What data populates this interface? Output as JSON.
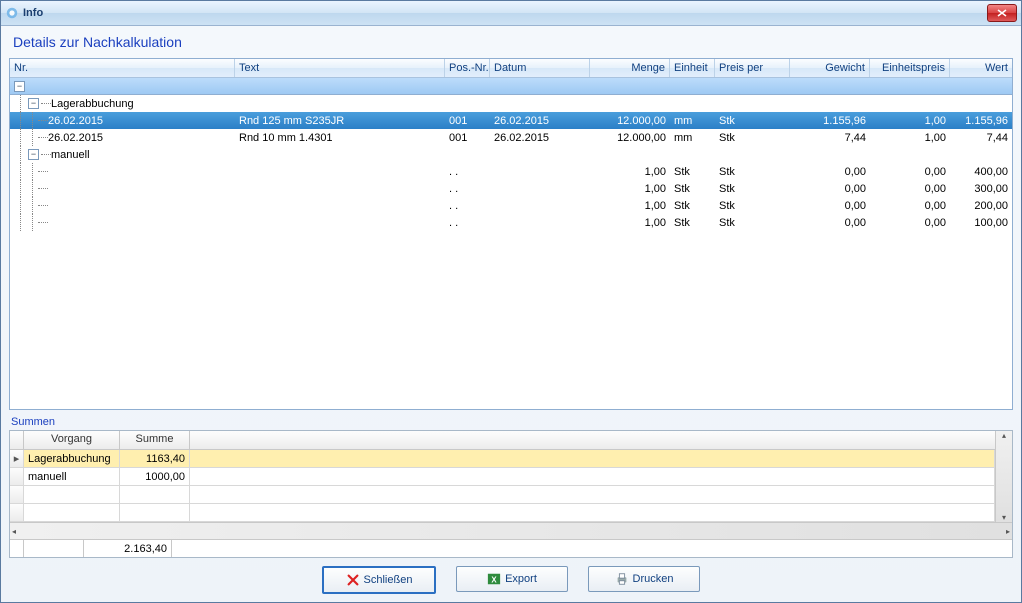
{
  "window": {
    "title": "Info"
  },
  "subtitle": "Details zur Nachkalkulation",
  "grid": {
    "headers": {
      "nr": "Nr.",
      "text": "Text",
      "pos": "Pos.-Nr.",
      "datum": "Datum",
      "menge": "Menge",
      "einheit": "Einheit",
      "preisper": "Preis per",
      "gewicht": "Gewicht",
      "ep": "Einheitspreis",
      "wert": "Wert"
    },
    "groups": [
      {
        "label": "Lagerabbuchung",
        "rows": [
          {
            "nr": "26.02.2015",
            "text": "Rnd 125 mm S235JR",
            "pos": "001",
            "datum": "26.02.2015",
            "menge": "12.000,00",
            "einheit": "mm",
            "preisper": "Stk",
            "gewicht": "1.155,96",
            "ep": "1,00",
            "wert": "1.155,96",
            "selected": true
          },
          {
            "nr": "26.02.2015",
            "text": "Rnd 10 mm 1.4301",
            "pos": "001",
            "datum": "26.02.2015",
            "menge": "12.000,00",
            "einheit": "mm",
            "preisper": "Stk",
            "gewicht": "7,44",
            "ep": "1,00",
            "wert": "7,44"
          }
        ]
      },
      {
        "label": "manuell",
        "rows": [
          {
            "nr": "",
            "text": "",
            "pos": ". .",
            "datum": "",
            "menge": "1,00",
            "einheit": "Stk",
            "preisper": "Stk",
            "gewicht": "0,00",
            "ep": "0,00",
            "wert": "400,00"
          },
          {
            "nr": "",
            "text": "",
            "pos": ". .",
            "datum": "",
            "menge": "1,00",
            "einheit": "Stk",
            "preisper": "Stk",
            "gewicht": "0,00",
            "ep": "0,00",
            "wert": "300,00"
          },
          {
            "nr": "",
            "text": "",
            "pos": ". .",
            "datum": "",
            "menge": "1,00",
            "einheit": "Stk",
            "preisper": "Stk",
            "gewicht": "0,00",
            "ep": "0,00",
            "wert": "200,00"
          },
          {
            "nr": "",
            "text": "",
            "pos": ". .",
            "datum": "",
            "menge": "1,00",
            "einheit": "Stk",
            "preisper": "Stk",
            "gewicht": "0,00",
            "ep": "0,00",
            "wert": "100,00"
          }
        ]
      }
    ]
  },
  "summen": {
    "label": "Summen",
    "headers": {
      "vorgang": "Vorgang",
      "summe": "Summe"
    },
    "rows": [
      {
        "vorgang": "Lagerabbuchung",
        "summe": "1163,40",
        "current": true
      },
      {
        "vorgang": "manuell",
        "summe": "1000,00"
      }
    ],
    "total": "2.163,40"
  },
  "buttons": {
    "close": "Schließen",
    "export": "Export",
    "print": "Drucken"
  }
}
